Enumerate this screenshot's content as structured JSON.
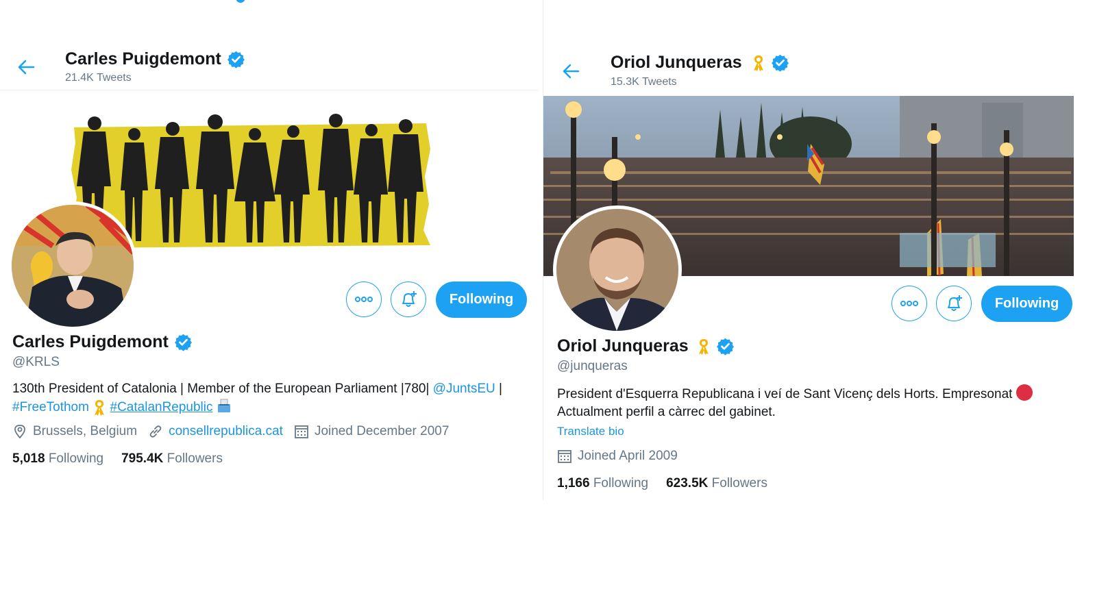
{
  "left_profile": {
    "header": {
      "name": "Carles Puigdemont",
      "tweet_count": "21.4K Tweets"
    },
    "display_name": "Carles Puigdemont",
    "handle": "@KRLS",
    "bio": {
      "line1_text": "130th President of Catalonia | Member of the European Parliament |780| ",
      "mention": "@JuntsEU",
      "line1_end": " |",
      "hashtag1": "#FreeTothom",
      "hashtag2": "#CatalanRepublic"
    },
    "location": "Brussels, Belgium",
    "website": "consellrepublica.cat",
    "joined": "Joined December 2007",
    "following_count": "5,018",
    "following_label": "Following",
    "followers_count": "795.4K",
    "followers_label": "Followers",
    "follow_button": "Following"
  },
  "right_profile": {
    "header": {
      "name": "Oriol Junqueras",
      "tweet_count": "15.3K Tweets"
    },
    "display_name": "Oriol Junqueras",
    "handle": "@junqueras",
    "bio": {
      "line1": "President d'Esquerra Republicana i veí de Sant Vicenç dels Horts. Empresonat",
      "line2": "Actualment perfil a càrrec del gabinet."
    },
    "translate_label": "Translate bio",
    "joined": "Joined April 2009",
    "following_count": "1,166",
    "following_label": "Following",
    "followers_count": "623.5K",
    "followers_label": "Followers",
    "follow_button": "Following"
  },
  "colors": {
    "accent": "#1da1f2",
    "link": "#1b95e0",
    "muted": "#657786",
    "ribbon": "#f4b400",
    "banner_yellow": "#e3cf2a"
  },
  "icons": [
    "back-arrow-icon",
    "verified-badge-icon",
    "yellow-ribbon-icon",
    "more-icon",
    "notification-bell-icon",
    "location-pin-icon",
    "link-icon",
    "calendar-icon",
    "ballot-box-icon",
    "red-circle-icon"
  ]
}
